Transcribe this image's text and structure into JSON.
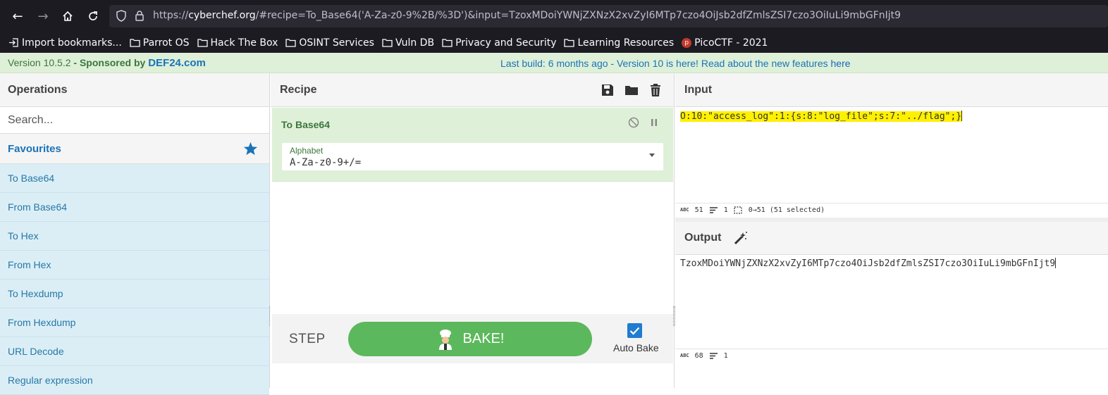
{
  "browser": {
    "url_prefix": "https://",
    "url_host": "cyberchef.org",
    "url_rest": "/#recipe=To_Base64('A-Za-z0-9%2B/%3D')&input=TzoxMDoiYWNjZXNzX2xvZyI6MTp7czo4OiJsb2dfZmlsZSI7czo3OiIuLi9mbGFnIjt9",
    "bookmarks": [
      "Import bookmarks...",
      "Parrot OS",
      "Hack The Box",
      "OSINT Services",
      "Vuln DB",
      "Privacy and Security",
      "Learning Resources",
      "PicoCTF - 2021"
    ]
  },
  "banner": {
    "version": "Version 10.5.2",
    "sponsored": " - Sponsored by ",
    "sponsor": "DEF24.com",
    "last_build_prefix": "Last build: 6 months ago - Version 10 is here! Read about the new features ",
    "here": "here"
  },
  "operations": {
    "title": "Operations",
    "search_placeholder": "Search...",
    "favourites": "Favourites",
    "items": [
      "To Base64",
      "From Base64",
      "To Hex",
      "From Hex",
      "To Hexdump",
      "From Hexdump",
      "URL Decode",
      "Regular expression"
    ]
  },
  "recipe": {
    "title": "Recipe",
    "op_name": "To Base64",
    "alphabet_label": "Alphabet",
    "alphabet_value": "A-Za-z0-9+/=",
    "step": "STEP",
    "bake": "BAKE!",
    "auto_bake": "Auto Bake"
  },
  "input": {
    "title": "Input",
    "text": "O:10:\"access_log\":1:{s:8:\"log_file\";s:7:\"../flag\";}",
    "chars": "51",
    "lines": "1",
    "selection": "0→51 (51 selected)"
  },
  "output": {
    "title": "Output",
    "text": "TzoxMDoiYWNjZXNzX2xvZyI6MTp7czo4OiJsb2dfZmlsZSI7czo3OiIuLi9mbGFnIjt9",
    "chars": "68",
    "lines": "1"
  },
  "colors": {
    "banner_bg": "#dff0d8",
    "bake_green": "#5cb85c",
    "op_item_bg": "#dbeef6",
    "highlight": "#fff000"
  }
}
